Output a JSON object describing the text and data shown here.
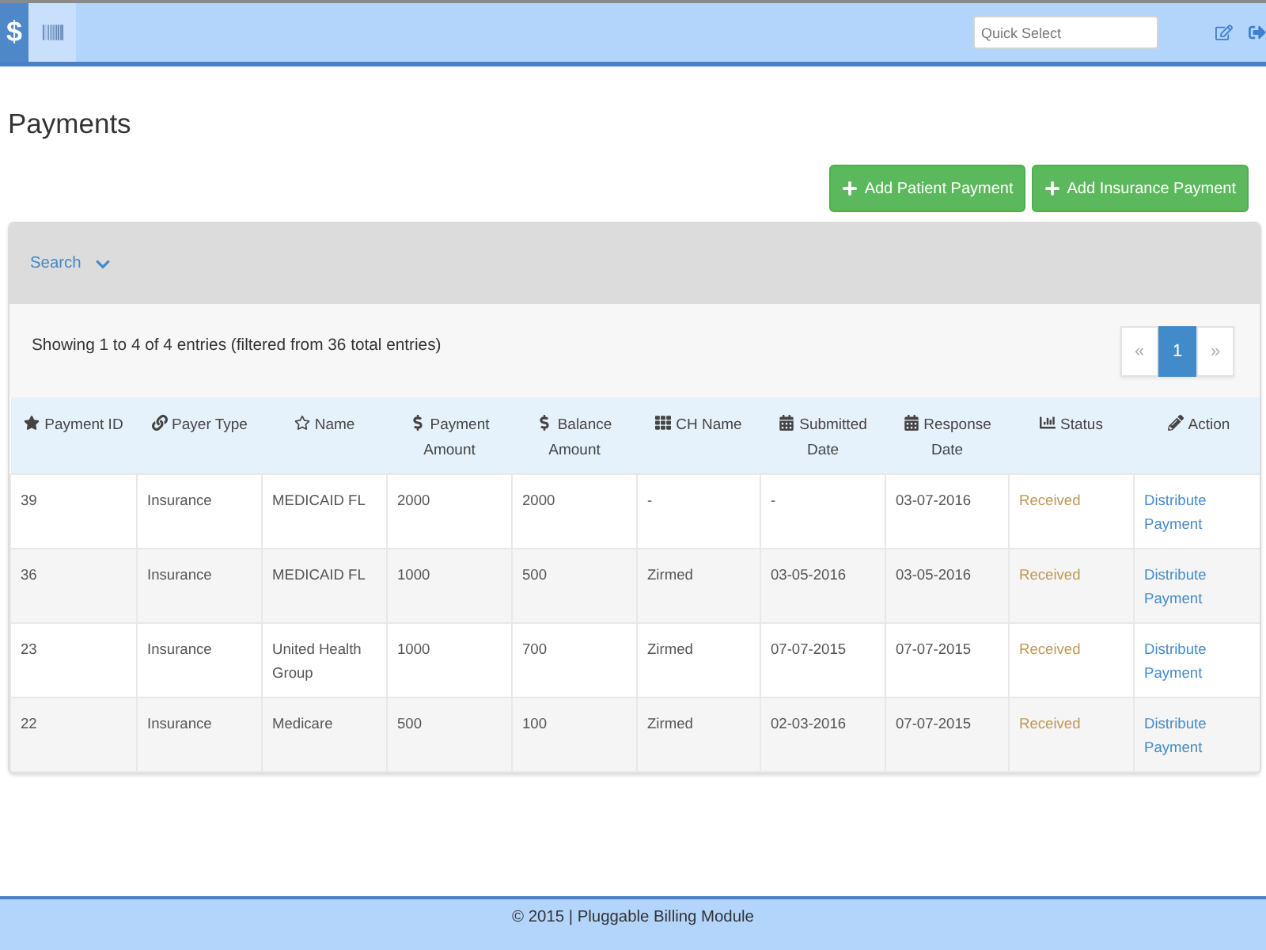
{
  "top_bar": {
    "logo": "$",
    "quick_select": {
      "placeholder": "Quick Select"
    }
  },
  "page_title": "Payments",
  "action_buttons": [
    "Add Patient Payment",
    "Add Insurance Payment"
  ],
  "search_panel": {
    "label": "Search"
  },
  "summary": "Showing 1 to 4 of 4 entries (filtered from 36 total entries)",
  "pagination": {
    "previous": {
      "label": "«",
      "disabled": true
    },
    "pages": [
      {
        "label": "1",
        "selected": true
      }
    ],
    "next": {
      "label": "»",
      "disabled": true
    }
  },
  "table": {
    "columns": [
      "Payment ID",
      "Payer Type",
      "Name",
      "Payment Amount",
      "Balance Amount",
      "CH Name",
      "Submitted Date",
      "Response Date",
      "Status",
      "Action"
    ],
    "rows": [
      [
        "39",
        "Insurance",
        "MEDICAID FL",
        "2000",
        "2000",
        "-",
        "-",
        "03-07-2016",
        "Received",
        "Distribute Payment"
      ],
      [
        "36",
        "Insurance",
        "MEDICAID FL",
        "1000",
        "500",
        "Zirmed",
        "03-05-2016",
        "03-05-2016",
        "Received",
        "Distribute Payment"
      ],
      [
        "23",
        "Insurance",
        "United Health Group",
        "1000",
        "700",
        "Zirmed",
        "07-07-2015",
        "07-07-2015",
        "Received",
        "Distribute Payment"
      ],
      [
        "22",
        "Insurance",
        "Medicare",
        "500",
        "100",
        "Zirmed",
        "02-03-2016",
        "07-07-2015",
        "Received",
        "Distribute Payment"
      ]
    ]
  },
  "footer": "© 2015 | Pluggable Billing Module"
}
